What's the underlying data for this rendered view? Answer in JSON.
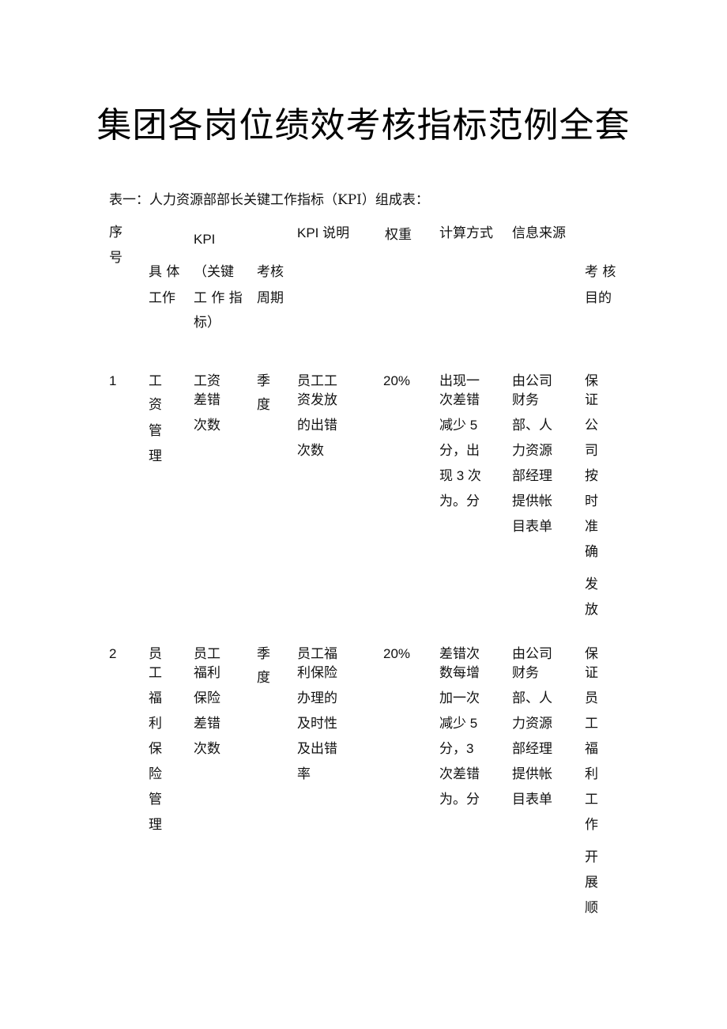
{
  "title": "集团各岗位绩效考核指标范例全套",
  "caption": "表一：人力资源部部长关键工作指标（KPI）组成表：",
  "header": {
    "seq": [
      "序",
      "号"
    ],
    "kpi": "KPI",
    "work": [
      "具 体",
      "工作"
    ],
    "kpi_full": [
      "（关键",
      "工 作 指",
      "标）"
    ],
    "period": [
      "考核",
      "周期"
    ],
    "kpi_desc": "KPI 说明",
    "weight": "权重",
    "calc": "计算方式",
    "source": "信息来源",
    "purpose": [
      "考 核",
      "目的"
    ]
  },
  "rows": [
    {
      "seq": "1",
      "work": [
        "工",
        "资",
        "管",
        "理"
      ],
      "kpi": [
        "工资",
        "差错",
        "次数"
      ],
      "period": [
        "季",
        "度"
      ],
      "desc": [
        "员工工",
        "资发放",
        "的出错",
        "次数"
      ],
      "weight": "20%",
      "calc": [
        "出现一",
        "次差错",
        "减少 5",
        "分，出",
        "现 3 次",
        "为。分"
      ],
      "source": [
        "由公司",
        "财务",
        "部、人",
        "力资源",
        "部经理",
        "提供帐",
        "目表单"
      ],
      "purpose": [
        "保",
        "证",
        "公",
        "司",
        "按",
        "时",
        "准",
        "确",
        "发",
        "放"
      ]
    },
    {
      "seq": "2",
      "work": [
        "员",
        "工",
        "福",
        "利",
        "保",
        "险",
        "管",
        "理"
      ],
      "kpi": [
        "员工",
        "福利",
        "保险",
        "差错",
        "次数"
      ],
      "period": [
        "季",
        "度"
      ],
      "desc": [
        "员工福",
        "利保险",
        "办理的",
        "及时性",
        "及出错",
        "率"
      ],
      "weight": "20%",
      "calc": [
        "差错次",
        "数每增",
        "加一次",
        "减少 5",
        "分，3",
        "次差错",
        "为。分"
      ],
      "source": [
        "由公司",
        "财务",
        "部、人",
        "力资源",
        "部经理",
        "提供帐",
        "目表单"
      ],
      "purpose": [
        "保",
        "证",
        "员",
        "工",
        "福",
        "利",
        "工",
        "作",
        "开",
        "展",
        "顺"
      ]
    }
  ]
}
